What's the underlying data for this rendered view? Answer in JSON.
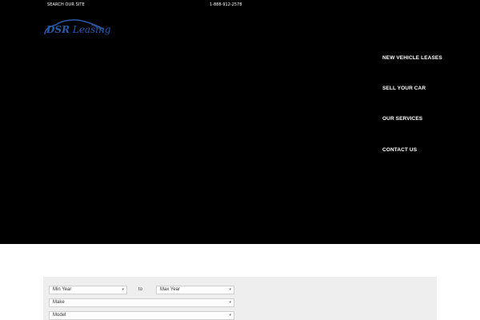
{
  "topbar": {
    "search_label": "SEARCH OUR SITE",
    "phone": "1-888-912-2578"
  },
  "logo": {
    "part1": "DSR",
    "part2": " Leasing",
    "color": "#2c5aa8"
  },
  "nav": {
    "items": [
      {
        "label": "NEW VEHICLE LEASES"
      },
      {
        "label": "SELL YOUR CAR"
      },
      {
        "label": "OUR SERVICES"
      },
      {
        "label": "CONTACT US"
      }
    ]
  },
  "search_form": {
    "min_year": "Min Year",
    "to_label": "to",
    "max_year": "Max Year",
    "make": "Make",
    "model": "Model"
  },
  "colors": {
    "hero_bg": "#000000",
    "panel_bg": "#eeeeee",
    "brand_blue": "#2c5aa8"
  }
}
